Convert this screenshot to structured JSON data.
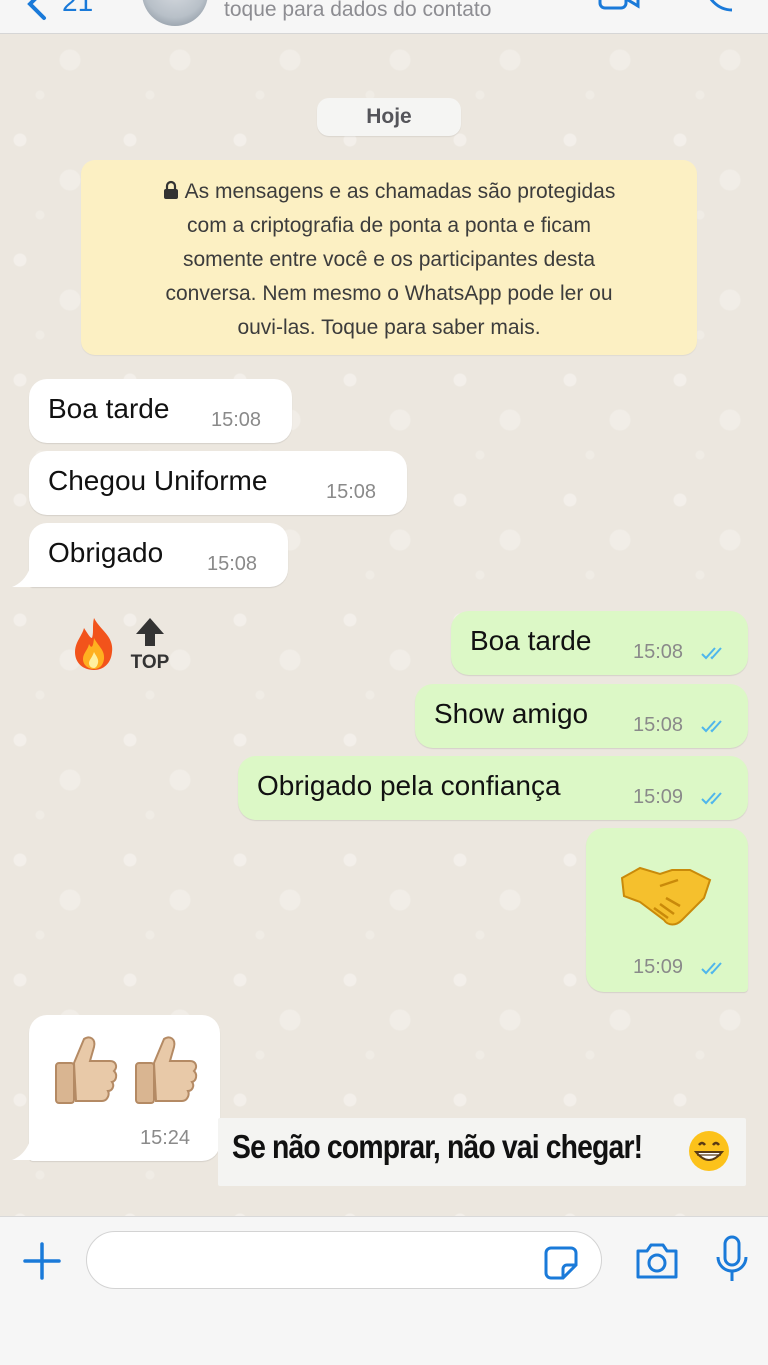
{
  "header": {
    "back_count": "21",
    "subtitle": "toque para dados do contato"
  },
  "date_divider": "Hoje",
  "encryption_notice": {
    "lines": [
      "As mensagens e as chamadas são protegidas",
      "com a criptografia de ponta a ponta e ficam",
      "somente entre você e os participantes desta",
      "conversa. Nem mesmo o WhatsApp pode ler ou",
      "ouvi-las. Toque para saber mais."
    ]
  },
  "messages": [
    {
      "direction": "in",
      "text": "Boa tarde",
      "time": "15:08"
    },
    {
      "direction": "in",
      "text": "Chegou Uniforme",
      "time": "15:08"
    },
    {
      "direction": "in",
      "text": "Obrigado",
      "time": "15:08"
    },
    {
      "direction": "in",
      "emoji": [
        "fire",
        "top-arrow"
      ],
      "top_label": "TOP"
    },
    {
      "direction": "out",
      "text": "Boa tarde",
      "time": "15:08",
      "status": "read"
    },
    {
      "direction": "out",
      "text": "Show amigo",
      "time": "15:08",
      "status": "read"
    },
    {
      "direction": "out",
      "text": "Obrigado pela confiança",
      "time": "15:09",
      "status": "read"
    },
    {
      "direction": "out",
      "emoji": [
        "handshake"
      ],
      "time": "15:09",
      "status": "read"
    },
    {
      "direction": "in",
      "emoji": [
        "thumbs-up",
        "thumbs-up"
      ],
      "time": "15:24"
    }
  ],
  "caption_overlay": {
    "text": "Se não comprar, não vai chegar!",
    "emoji": "grinning-face"
  },
  "composer": {
    "value": "",
    "placeholder": ""
  },
  "colors": {
    "incoming_bubble": "#ffffff",
    "outgoing_bubble": "#dcf8c6",
    "read_ticks": "#4fb6ec",
    "accent": "#1a7ad9",
    "notice_bg": "#fcf0c3"
  }
}
